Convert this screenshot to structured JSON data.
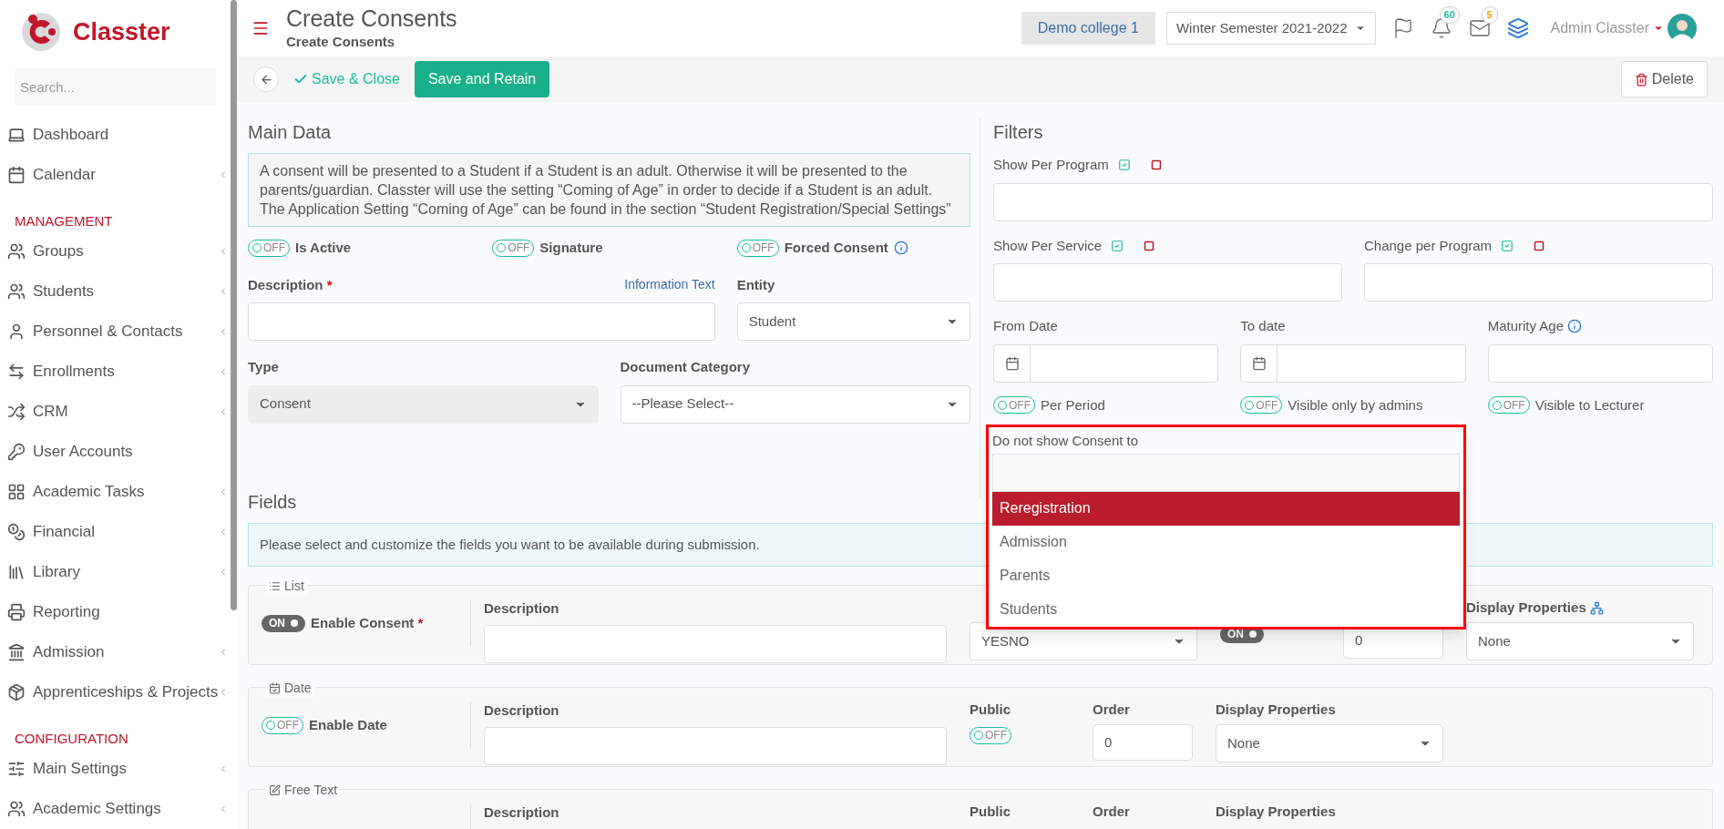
{
  "sidebar": {
    "logo": "Classter",
    "search_placeholder": "Search...",
    "sections": [
      {
        "items": [
          {
            "label": "Dashboard",
            "expandable": false
          },
          {
            "label": "Calendar",
            "expandable": true
          }
        ]
      },
      {
        "heading": "MANAGEMENT",
        "items": [
          {
            "label": "Groups",
            "expandable": true
          },
          {
            "label": "Students",
            "expandable": true
          },
          {
            "label": "Personnel & Contacts",
            "expandable": true
          },
          {
            "label": "Enrollments",
            "expandable": true
          },
          {
            "label": "CRM",
            "expandable": true
          },
          {
            "label": "User Accounts",
            "expandable": false
          },
          {
            "label": "Academic Tasks",
            "expandable": true
          },
          {
            "label": "Financial",
            "expandable": true
          },
          {
            "label": "Library",
            "expandable": true
          },
          {
            "label": "Reporting",
            "expandable": false
          },
          {
            "label": "Admission",
            "expandable": true
          },
          {
            "label": "Apprenticeships & Projects",
            "expandable": true
          }
        ]
      },
      {
        "heading": "CONFIGURATION",
        "items": [
          {
            "label": "Main Settings",
            "expandable": true
          },
          {
            "label": "Academic Settings",
            "expandable": true
          }
        ]
      }
    ]
  },
  "header": {
    "title": "Create Consents",
    "subtitle": "Create Consents",
    "college": "Demo college 1",
    "semester": "Winter Semester 2021-2022",
    "notifications": "60",
    "messages": "5",
    "user": "Admin Classter"
  },
  "toolbar": {
    "save_close": "Save & Close",
    "save_retain": "Save and Retain",
    "delete": "Delete"
  },
  "main_data": {
    "heading": "Main Data",
    "notice": "A consent will be presented to a Student if a Student is an adult. Otherwise it will be presented to the parents/guardian. Classter will use the setting “Coming of Age” in order to decide if a Student is an adult. The Application Setting “Coming of Age” can be found in the section “Student Registration/Special Settings”",
    "toggles": [
      {
        "label": "Is Active",
        "text": "OFF",
        "on": false,
        "info": false
      },
      {
        "label": "Signature",
        "text": "OFF",
        "on": false,
        "info": false
      },
      {
        "label": "Forced Consent",
        "text": "OFF",
        "on": false,
        "info": true
      }
    ],
    "description": {
      "label": "Description",
      "required_mark": "*",
      "link": "Information Text"
    },
    "entity": {
      "label": "Entity",
      "value": "Student"
    },
    "type": {
      "label": "Type",
      "value": "Consent",
      "disabled": true
    },
    "document_category": {
      "label": "Document Category",
      "value": "--Please Select--"
    }
  },
  "filters": {
    "heading": "Filters",
    "show_per_program": {
      "label": "Show Per Program"
    },
    "show_per_service": {
      "label": "Show Per Service"
    },
    "change_per_program": {
      "label": "Change per Program"
    },
    "from_date": {
      "label": "From Date"
    },
    "to_date": {
      "label": "To date"
    },
    "maturity_age": {
      "label": "Maturity Age"
    },
    "toggles": [
      {
        "label": "Per Period",
        "text": "OFF",
        "on": false
      },
      {
        "label": "Visible only by admins",
        "text": "OFF",
        "on": false
      },
      {
        "label": "Visible to Lecturer",
        "text": "OFF",
        "on": false
      }
    ],
    "exclude": {
      "label": "Do not show Consent to",
      "options": [
        {
          "label": "Reregistration",
          "selected": true
        },
        {
          "label": "Admission",
          "selected": false
        },
        {
          "label": "Parents",
          "selected": false
        },
        {
          "label": "Students",
          "selected": false
        }
      ]
    }
  },
  "fields": {
    "heading": "Fields",
    "notice": "Please select and customize the fields you want to be available during submission.",
    "rows": [
      {
        "legend": "List",
        "toggle": {
          "text": "ON",
          "on": true
        },
        "label": "Enable Consent",
        "required_mark": "*",
        "description_label": "Description",
        "columns": [
          {
            "kind": "select",
            "value": "YESNO"
          },
          {
            "kind": "toggle",
            "text": "ON",
            "on": true
          },
          {
            "kind": "number",
            "value": "0"
          },
          {
            "kind": "select",
            "label": "Display Properties",
            "value": "None",
            "icon": true
          }
        ]
      },
      {
        "legend": "Date",
        "toggle": {
          "text": "OFF",
          "on": false
        },
        "label": "Enable Date",
        "description_label": "Description",
        "columns": [
          {
            "kind": "toggle",
            "label": "Public",
            "text": "OFF",
            "on": false
          },
          {
            "kind": "number",
            "label": "Order",
            "value": "0"
          },
          {
            "kind": "select",
            "label": "Display Properties",
            "value": "None"
          }
        ]
      },
      {
        "legend": "Free Text",
        "description_label": "Description",
        "columns": [
          {
            "kind": "label",
            "label": "Public"
          },
          {
            "kind": "label",
            "label": "Order"
          },
          {
            "kind": "label",
            "label": "Display Properties"
          }
        ]
      }
    ]
  }
}
